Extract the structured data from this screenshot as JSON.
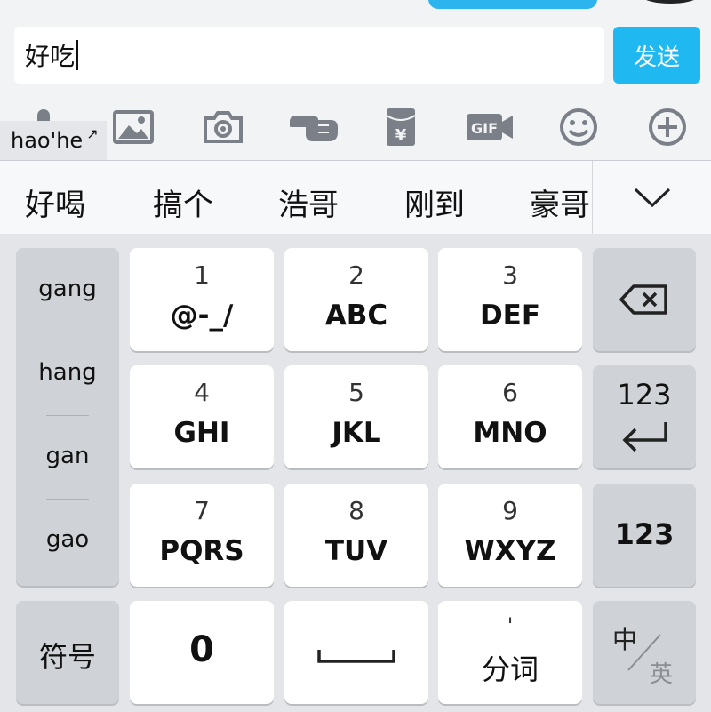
{
  "input": {
    "value": "好吃",
    "send_label": "发送"
  },
  "toolbar": {
    "items": [
      {
        "icon": "mic-icon"
      },
      {
        "icon": "image-icon"
      },
      {
        "icon": "camera-icon"
      },
      {
        "icon": "poke-icon"
      },
      {
        "icon": "red-packet-icon",
        "symbol": "¥"
      },
      {
        "icon": "gif-icon",
        "label": "GIF"
      },
      {
        "icon": "emoji-icon"
      },
      {
        "icon": "plus-icon"
      }
    ]
  },
  "composition": {
    "pinyin": "hao'he",
    "arrow": "↗"
  },
  "candidates": {
    "items": [
      "好喝",
      "搞个",
      "浩哥",
      "刚到",
      "豪哥"
    ],
    "expand_icon": "chevron-down-icon"
  },
  "keyboard": {
    "pinyin_options": [
      "gang",
      "hang",
      "gan",
      "gao"
    ],
    "keys": [
      {
        "num": "1",
        "letters": "@-_/"
      },
      {
        "num": "2",
        "letters": "ABC"
      },
      {
        "num": "3",
        "letters": "DEF"
      },
      {
        "num": "4",
        "letters": "GHI"
      },
      {
        "num": "5",
        "letters": "JKL"
      },
      {
        "num": "6",
        "letters": "MNO"
      },
      {
        "num": "7",
        "letters": "PQRS"
      },
      {
        "num": "8",
        "letters": "TUV"
      },
      {
        "num": "9",
        "letters": "WXYZ"
      }
    ],
    "backspace_icon": "backspace-icon",
    "enter_label": "123",
    "enter_icon": "enter-icon",
    "num_label": "123",
    "symbols_label": "符号",
    "zero_label": "0",
    "space_icon": "space-icon",
    "split_mark": "'",
    "split_label": "分词",
    "lang_zh": "中",
    "lang_en": "英"
  }
}
